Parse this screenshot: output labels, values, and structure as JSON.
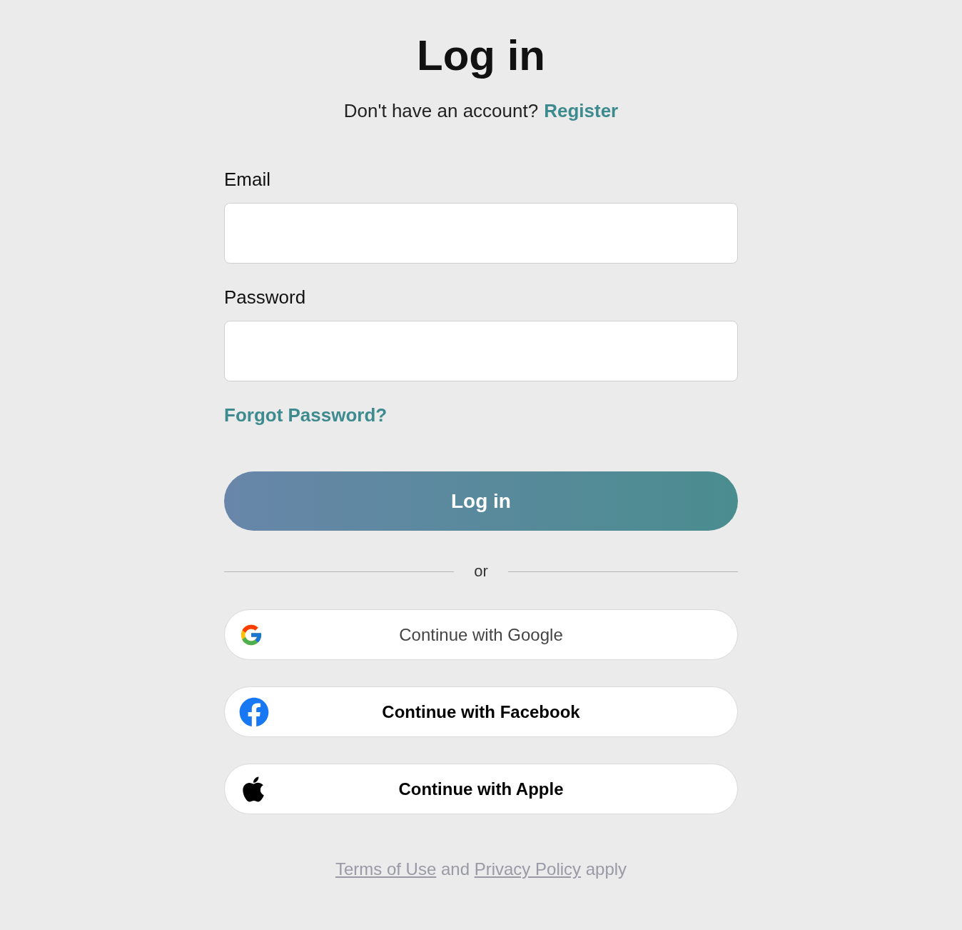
{
  "title": "Log in",
  "signup_prompt": {
    "text": "Don't have an account?",
    "link": "Register"
  },
  "fields": [
    {
      "label": "Email"
    },
    {
      "label": "Password"
    }
  ],
  "forgot_link": "Forgot Password?",
  "submit_button": "Log in",
  "divider": "or",
  "social_buttons": [
    {
      "kind": "google",
      "label": "Continue with Google"
    },
    {
      "kind": "facebook",
      "label": "Continue with Facebook"
    },
    {
      "kind": "apple",
      "label": "Continue with Apple"
    }
  ],
  "footer": {
    "links": [
      "Terms of Use",
      "Privacy Policy"
    ],
    "joiner": "and",
    "tail": "apply"
  }
}
